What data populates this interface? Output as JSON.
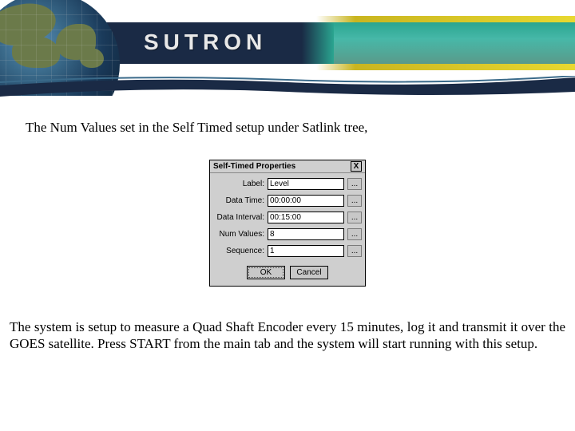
{
  "brand": "SUTRON",
  "intro_text": "The Num Values set in the Self Timed setup under Satlink tree,",
  "dialog": {
    "title": "Self-Timed Properties",
    "close": "X",
    "rows": {
      "label": {
        "label": "Label:",
        "value": "Level"
      },
      "data_time": {
        "label": "Data Time:",
        "value": "00:00:00"
      },
      "data_interval": {
        "label": "Data Interval:",
        "value": "00:15:00"
      },
      "num_values": {
        "label": "Num Values:",
        "value": "8"
      },
      "sequence": {
        "label": "Sequence:",
        "value": "1"
      }
    },
    "dots": "...",
    "ok": "OK",
    "cancel": "Cancel"
  },
  "paragraph": "The system is setup to measure a Quad Shaft Encoder every 15 minutes, log it and transmit it over the GOES satellite. Press START from the main tab and the system will start running with this setup."
}
